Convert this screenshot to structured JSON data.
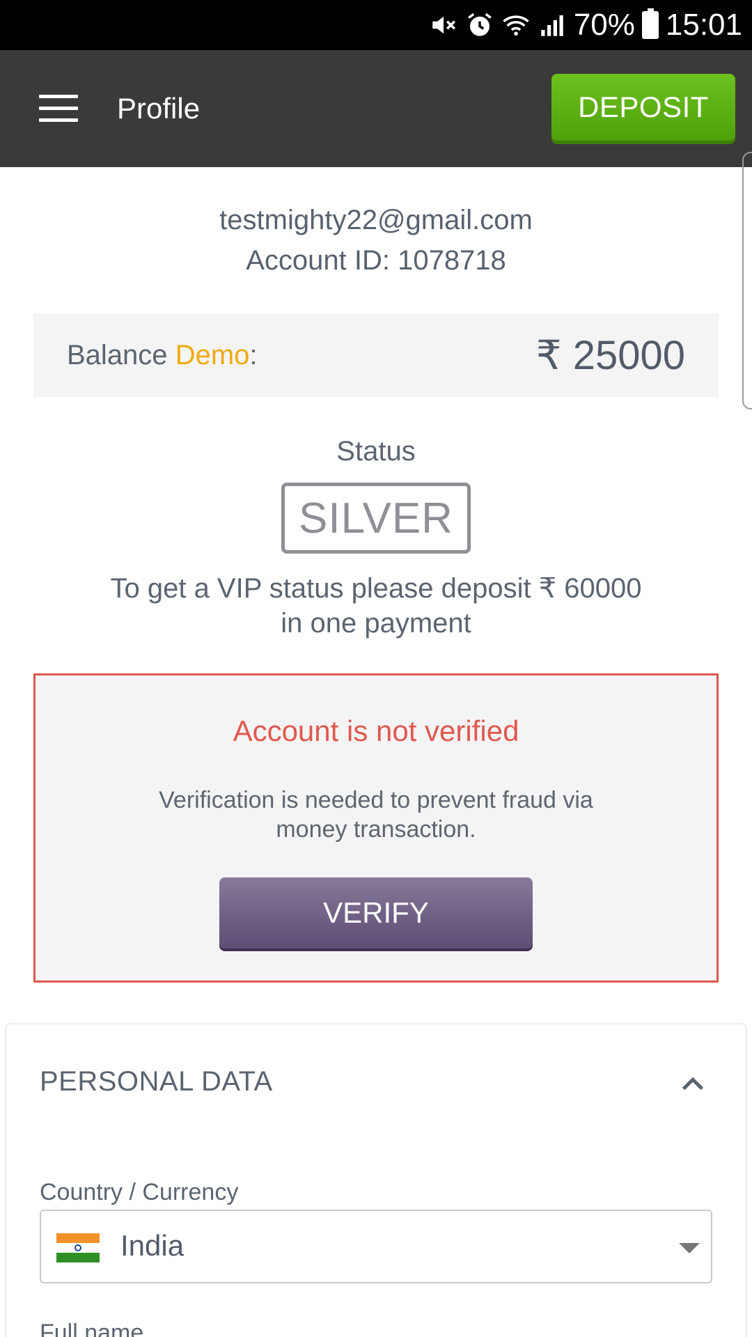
{
  "status_bar": {
    "battery": "70%",
    "time": "15:01",
    "icons": [
      "mute-icon",
      "alarm-icon",
      "wifi-icon",
      "signal-icon",
      "battery-icon"
    ]
  },
  "app_bar": {
    "title": "Profile",
    "deposit_label": "DEPOSIT",
    "colors": {
      "bar": "#3a3a3a",
      "deposit": "#5fb414"
    }
  },
  "account": {
    "email": "testmighty22@gmail.com",
    "account_id_label": "Account ID: 1078718"
  },
  "balance": {
    "label": "Balance",
    "mode": "Demo",
    "suffix": ":",
    "value": "₹ 25000",
    "mode_color": "#f0a90f"
  },
  "status": {
    "title": "Status",
    "badge": "SILVER",
    "vip_line1": "To get a VIP status please deposit ₹ 60000",
    "vip_line2": "in one payment"
  },
  "verification": {
    "title": "Account is not verified",
    "description_line1": "Verification is needed to prevent fraud via",
    "description_line2": "money transaction.",
    "button_label": "VERIFY",
    "colors": {
      "alert": "#e0584e",
      "button": "#6f5f86"
    }
  },
  "personal_data": {
    "title": "PERSONAL DATA",
    "country_label": "Country / Currency",
    "country_value": "India",
    "fullname_label": "Full name"
  }
}
